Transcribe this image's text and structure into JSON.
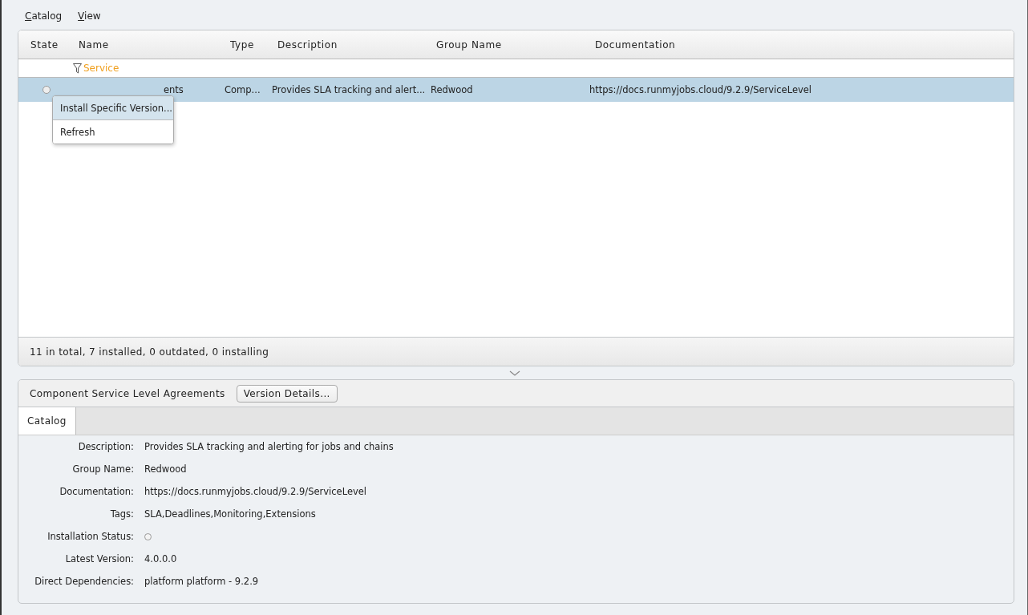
{
  "menu_bar": [
    {
      "label": "Catalog"
    },
    {
      "label": "View"
    }
  ],
  "table": {
    "columns": [
      {
        "label": "State"
      },
      {
        "label": "Name",
        "filter": "Service"
      },
      {
        "label": "Type"
      },
      {
        "label": "Description"
      },
      {
        "label": "Group Name"
      },
      {
        "label": "Documentation"
      }
    ],
    "rows": [
      {
        "installed": false,
        "name": "ents",
        "type": "Comp...",
        "description": "Provides SLA tracking and alert...",
        "group_name": "Redwood",
        "documentation": "https://docs.runmyjobs.cloud/9.2.9/ServiceLevel",
        "selected": true
      }
    ]
  },
  "context_menu": {
    "items": [
      {
        "label": "Install Specific Version...",
        "selected": true
      },
      {
        "label": "Refresh",
        "selected": false
      }
    ]
  },
  "status_bar": "11 in total, 7 installed, 0 outdated, 0 installing",
  "details": {
    "title": "Component Service Level Agreements",
    "button": "Version Details...",
    "tabs": [
      {
        "label": "Catalog",
        "selected": true
      }
    ],
    "fields": [
      {
        "label": "Description:",
        "kind": "text",
        "value": "Provides SLA tracking and alerting for jobs and chains"
      },
      {
        "label": "Group Name:",
        "kind": "text",
        "value": "Redwood"
      },
      {
        "label": "Documentation:",
        "kind": "text",
        "value": "https://docs.runmyjobs.cloud/9.2.9/ServiceLevel"
      },
      {
        "label": "Tags:",
        "kind": "text",
        "value": "SLA,Deadlines,Monitoring,Extensions"
      },
      {
        "label": "Installation Status:",
        "kind": "status",
        "installed": false
      },
      {
        "label": "Latest Version:",
        "kind": "text",
        "value": "4.0.0.0"
      },
      {
        "label": "Direct Dependencies:",
        "kind": "text",
        "value": "platform platform - 9.2.9"
      }
    ]
  }
}
